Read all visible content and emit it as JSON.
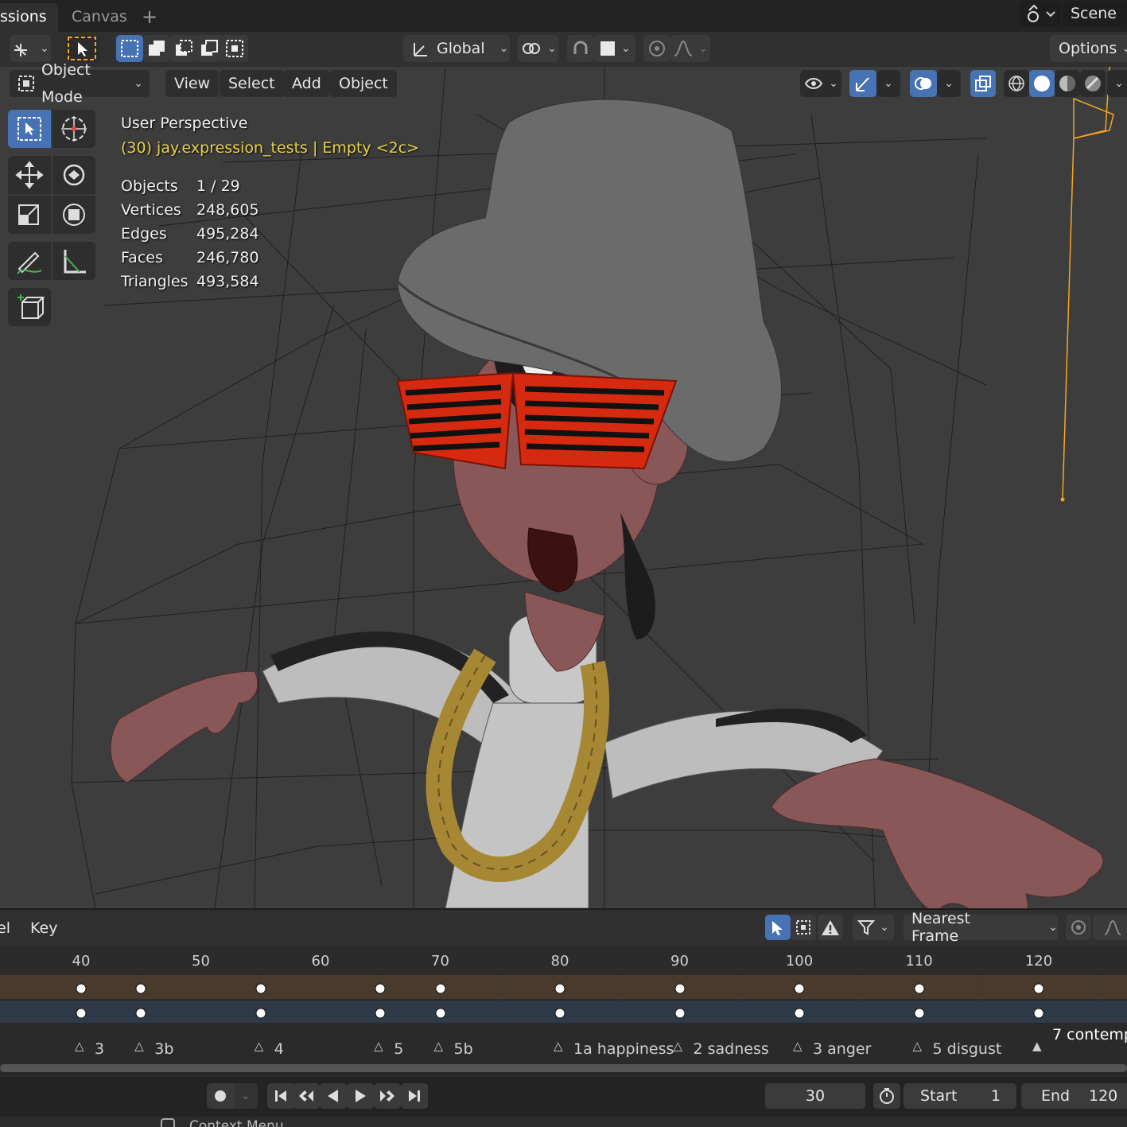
{
  "workspace_tabs": [
    {
      "label": "ssions",
      "active": true
    },
    {
      "label": "Canvas",
      "active": false
    }
  ],
  "add_tab_icon": "plus-icon",
  "scene": {
    "icon": "scene-icon",
    "label": "Scene"
  },
  "header": {
    "orientation": "Global",
    "options_label": "Options"
  },
  "viewport_header": {
    "mode": "Object Mode",
    "menus": [
      "View",
      "Select",
      "Add",
      "Object"
    ]
  },
  "overlay": {
    "view_name": "User Perspective",
    "context": "(30) jay.expression_tests | Empty <2c>",
    "stats": [
      {
        "label": "Objects",
        "value": "1 / 29"
      },
      {
        "label": "Vertices",
        "value": "248,605"
      },
      {
        "label": "Edges",
        "value": "495,284"
      },
      {
        "label": "Faces",
        "value": "246,780"
      },
      {
        "label": "Triangles",
        "value": "493,584"
      }
    ]
  },
  "timeline": {
    "menus": [
      "el",
      "Key"
    ],
    "snap_mode": "Nearest Frame",
    "ruler": [
      "40",
      "50",
      "60",
      "70",
      "80",
      "90",
      "100",
      "110",
      "120"
    ],
    "keyframe_frames": [
      40,
      45,
      55,
      65,
      70,
      80,
      90,
      100,
      110,
      120
    ],
    "markers": [
      {
        "label": "3",
        "frame": 40
      },
      {
        "label": "3b",
        "frame": 45
      },
      {
        "label": "4",
        "frame": 55
      },
      {
        "label": "5",
        "frame": 65
      },
      {
        "label": "5b",
        "frame": 70
      },
      {
        "label": "1a happiness",
        "frame": 80
      },
      {
        "label": "2 sadness",
        "frame": 90
      },
      {
        "label": "3 anger",
        "frame": 100
      },
      {
        "label": "5 disgust",
        "frame": 110
      },
      {
        "label": "7 contemp",
        "frame": 120
      }
    ],
    "current_frame": "30",
    "start_label": "Start",
    "start_value": "1",
    "end_label": "End",
    "end_value": "120"
  },
  "status_bar": {
    "text": "Context Menu"
  },
  "colors": {
    "accent": "#4772b3",
    "selection_orange": "#f5a623",
    "context_yellow": "#e8d34a"
  }
}
